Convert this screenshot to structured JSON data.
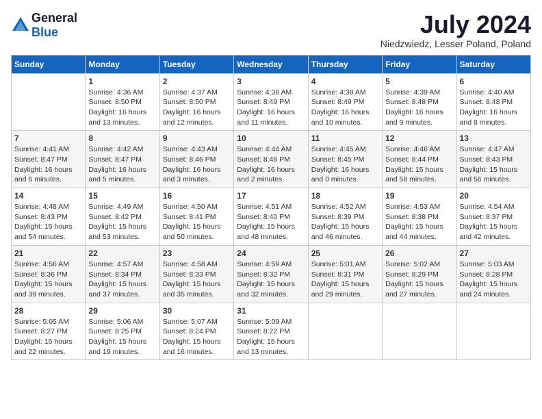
{
  "header": {
    "logo_general": "General",
    "logo_blue": "Blue",
    "month_title": "July 2024",
    "location": "Niedzwiedz, Lesser Poland, Poland"
  },
  "days_of_week": [
    "Sunday",
    "Monday",
    "Tuesday",
    "Wednesday",
    "Thursday",
    "Friday",
    "Saturday"
  ],
  "weeks": [
    [
      {
        "day": "",
        "sunrise": "",
        "sunset": "",
        "daylight": ""
      },
      {
        "day": "1",
        "sunrise": "Sunrise: 4:36 AM",
        "sunset": "Sunset: 8:50 PM",
        "daylight": "Daylight: 16 hours and 13 minutes."
      },
      {
        "day": "2",
        "sunrise": "Sunrise: 4:37 AM",
        "sunset": "Sunset: 8:50 PM",
        "daylight": "Daylight: 16 hours and 12 minutes."
      },
      {
        "day": "3",
        "sunrise": "Sunrise: 4:38 AM",
        "sunset": "Sunset: 8:49 PM",
        "daylight": "Daylight: 16 hours and 11 minutes."
      },
      {
        "day": "4",
        "sunrise": "Sunrise: 4:38 AM",
        "sunset": "Sunset: 8:49 PM",
        "daylight": "Daylight: 16 hours and 10 minutes."
      },
      {
        "day": "5",
        "sunrise": "Sunrise: 4:39 AM",
        "sunset": "Sunset: 8:48 PM",
        "daylight": "Daylight: 16 hours and 9 minutes."
      },
      {
        "day": "6",
        "sunrise": "Sunrise: 4:40 AM",
        "sunset": "Sunset: 8:48 PM",
        "daylight": "Daylight: 16 hours and 8 minutes."
      }
    ],
    [
      {
        "day": "7",
        "sunrise": "Sunrise: 4:41 AM",
        "sunset": "Sunset: 8:47 PM",
        "daylight": "Daylight: 16 hours and 6 minutes."
      },
      {
        "day": "8",
        "sunrise": "Sunrise: 4:42 AM",
        "sunset": "Sunset: 8:47 PM",
        "daylight": "Daylight: 16 hours and 5 minutes."
      },
      {
        "day": "9",
        "sunrise": "Sunrise: 4:43 AM",
        "sunset": "Sunset: 8:46 PM",
        "daylight": "Daylight: 16 hours and 3 minutes."
      },
      {
        "day": "10",
        "sunrise": "Sunrise: 4:44 AM",
        "sunset": "Sunset: 8:46 PM",
        "daylight": "Daylight: 16 hours and 2 minutes."
      },
      {
        "day": "11",
        "sunrise": "Sunrise: 4:45 AM",
        "sunset": "Sunset: 8:45 PM",
        "daylight": "Daylight: 16 hours and 0 minutes."
      },
      {
        "day": "12",
        "sunrise": "Sunrise: 4:46 AM",
        "sunset": "Sunset: 8:44 PM",
        "daylight": "Daylight: 15 hours and 58 minutes."
      },
      {
        "day": "13",
        "sunrise": "Sunrise: 4:47 AM",
        "sunset": "Sunset: 8:43 PM",
        "daylight": "Daylight: 15 hours and 56 minutes."
      }
    ],
    [
      {
        "day": "14",
        "sunrise": "Sunrise: 4:48 AM",
        "sunset": "Sunset: 8:43 PM",
        "daylight": "Daylight: 15 hours and 54 minutes."
      },
      {
        "day": "15",
        "sunrise": "Sunrise: 4:49 AM",
        "sunset": "Sunset: 8:42 PM",
        "daylight": "Daylight: 15 hours and 53 minutes."
      },
      {
        "day": "16",
        "sunrise": "Sunrise: 4:50 AM",
        "sunset": "Sunset: 8:41 PM",
        "daylight": "Daylight: 15 hours and 50 minutes."
      },
      {
        "day": "17",
        "sunrise": "Sunrise: 4:51 AM",
        "sunset": "Sunset: 8:40 PM",
        "daylight": "Daylight: 15 hours and 48 minutes."
      },
      {
        "day": "18",
        "sunrise": "Sunrise: 4:52 AM",
        "sunset": "Sunset: 8:39 PM",
        "daylight": "Daylight: 15 hours and 46 minutes."
      },
      {
        "day": "19",
        "sunrise": "Sunrise: 4:53 AM",
        "sunset": "Sunset: 8:38 PM",
        "daylight": "Daylight: 15 hours and 44 minutes."
      },
      {
        "day": "20",
        "sunrise": "Sunrise: 4:54 AM",
        "sunset": "Sunset: 8:37 PM",
        "daylight": "Daylight: 15 hours and 42 minutes."
      }
    ],
    [
      {
        "day": "21",
        "sunrise": "Sunrise: 4:56 AM",
        "sunset": "Sunset: 8:36 PM",
        "daylight": "Daylight: 15 hours and 39 minutes."
      },
      {
        "day": "22",
        "sunrise": "Sunrise: 4:57 AM",
        "sunset": "Sunset: 8:34 PM",
        "daylight": "Daylight: 15 hours and 37 minutes."
      },
      {
        "day": "23",
        "sunrise": "Sunrise: 4:58 AM",
        "sunset": "Sunset: 8:33 PM",
        "daylight": "Daylight: 15 hours and 35 minutes."
      },
      {
        "day": "24",
        "sunrise": "Sunrise: 4:59 AM",
        "sunset": "Sunset: 8:32 PM",
        "daylight": "Daylight: 15 hours and 32 minutes."
      },
      {
        "day": "25",
        "sunrise": "Sunrise: 5:01 AM",
        "sunset": "Sunset: 8:31 PM",
        "daylight": "Daylight: 15 hours and 29 minutes."
      },
      {
        "day": "26",
        "sunrise": "Sunrise: 5:02 AM",
        "sunset": "Sunset: 8:29 PM",
        "daylight": "Daylight: 15 hours and 27 minutes."
      },
      {
        "day": "27",
        "sunrise": "Sunrise: 5:03 AM",
        "sunset": "Sunset: 8:28 PM",
        "daylight": "Daylight: 15 hours and 24 minutes."
      }
    ],
    [
      {
        "day": "28",
        "sunrise": "Sunrise: 5:05 AM",
        "sunset": "Sunset: 8:27 PM",
        "daylight": "Daylight: 15 hours and 22 minutes."
      },
      {
        "day": "29",
        "sunrise": "Sunrise: 5:06 AM",
        "sunset": "Sunset: 8:25 PM",
        "daylight": "Daylight: 15 hours and 19 minutes."
      },
      {
        "day": "30",
        "sunrise": "Sunrise: 5:07 AM",
        "sunset": "Sunset: 8:24 PM",
        "daylight": "Daylight: 15 hours and 16 minutes."
      },
      {
        "day": "31",
        "sunrise": "Sunrise: 5:09 AM",
        "sunset": "Sunset: 8:22 PM",
        "daylight": "Daylight: 15 hours and 13 minutes."
      },
      {
        "day": "",
        "sunrise": "",
        "sunset": "",
        "daylight": ""
      },
      {
        "day": "",
        "sunrise": "",
        "sunset": "",
        "daylight": ""
      },
      {
        "day": "",
        "sunrise": "",
        "sunset": "",
        "daylight": ""
      }
    ]
  ]
}
